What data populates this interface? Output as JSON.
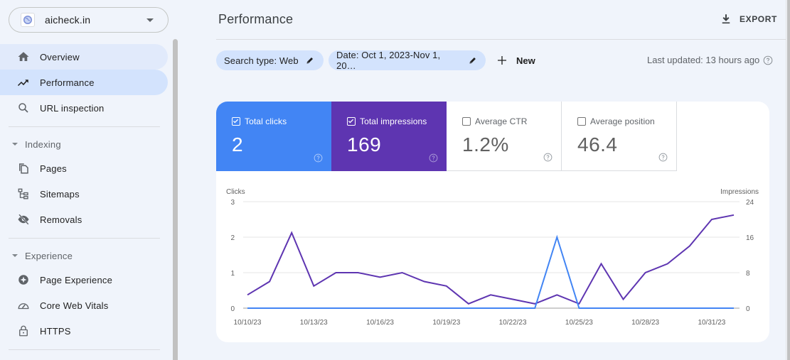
{
  "property": {
    "name": "aicheck.in",
    "icon": "globe-icon"
  },
  "sidebar": {
    "top_items": [
      {
        "label": "Overview",
        "icon": "home-icon",
        "state": "hover"
      },
      {
        "label": "Performance",
        "icon": "trending-up-icon",
        "state": "active"
      },
      {
        "label": "URL inspection",
        "icon": "search-icon",
        "state": ""
      }
    ],
    "sections": [
      {
        "label": "Indexing",
        "items": [
          {
            "label": "Pages",
            "icon": "pages-icon"
          },
          {
            "label": "Sitemaps",
            "icon": "sitemap-icon"
          },
          {
            "label": "Removals",
            "icon": "visibility-off-icon"
          }
        ]
      },
      {
        "label": "Experience",
        "items": [
          {
            "label": "Page Experience",
            "icon": "page-experience-icon"
          },
          {
            "label": "Core Web Vitals",
            "icon": "speed-gauge-icon"
          },
          {
            "label": "HTTPS",
            "icon": "lock-icon"
          }
        ]
      }
    ]
  },
  "header": {
    "title": "Performance",
    "export_label": "EXPORT"
  },
  "filters": {
    "search_type": "Search type: Web",
    "date": "Date: Oct 1, 2023-Nov 1, 20…",
    "new_label": "New",
    "last_updated": "Last updated: 13 hours ago"
  },
  "metrics": [
    {
      "label": "Total clicks",
      "value": "2",
      "checked": true,
      "color": "#4285f4"
    },
    {
      "label": "Total impressions",
      "value": "169",
      "checked": true,
      "color": "#5e35b1"
    },
    {
      "label": "Average CTR",
      "value": "1.2%",
      "checked": false,
      "color": "#ffffff"
    },
    {
      "label": "Average position",
      "value": "46.4",
      "checked": false,
      "color": "#ffffff"
    }
  ],
  "chart_data": {
    "type": "line",
    "title": "",
    "xlabel": "",
    "y_left_label": "Clicks",
    "y_right_label": "Impressions",
    "y_left_range": [
      0,
      3
    ],
    "y_right_range": [
      0,
      24
    ],
    "y_left_ticks": [
      "0",
      "1",
      "2",
      "3"
    ],
    "y_right_ticks": [
      "0",
      "8",
      "16",
      "24"
    ],
    "x_tick_labels": [
      "10/10/23",
      "10/13/23",
      "10/16/23",
      "10/19/23",
      "10/22/23",
      "10/25/23",
      "10/28/23",
      "10/31/23"
    ],
    "x": [
      "10/10/23",
      "10/11/23",
      "10/12/23",
      "10/13/23",
      "10/14/23",
      "10/15/23",
      "10/16/23",
      "10/17/23",
      "10/18/23",
      "10/19/23",
      "10/20/23",
      "10/21/23",
      "10/22/23",
      "10/23/23",
      "10/24/23",
      "10/25/23",
      "10/26/23",
      "10/27/23",
      "10/28/23",
      "10/29/23",
      "10/30/23",
      "10/31/23",
      "11/1/23"
    ],
    "grid": true,
    "series": [
      {
        "name": "Clicks",
        "axis": "left",
        "color": "#4285f4",
        "values": [
          0,
          0,
          0,
          0,
          0,
          0,
          0,
          0,
          0,
          0,
          0,
          0,
          0,
          0,
          2,
          0,
          0,
          0,
          0,
          0,
          0,
          0,
          0
        ]
      },
      {
        "name": "Impressions",
        "axis": "right",
        "color": "#5e35b1",
        "values": [
          3,
          6,
          17,
          5,
          8,
          8,
          7,
          8,
          6,
          5,
          1,
          3,
          2,
          1,
          3,
          1,
          10,
          2,
          8,
          10,
          14,
          20,
          21
        ]
      }
    ]
  }
}
